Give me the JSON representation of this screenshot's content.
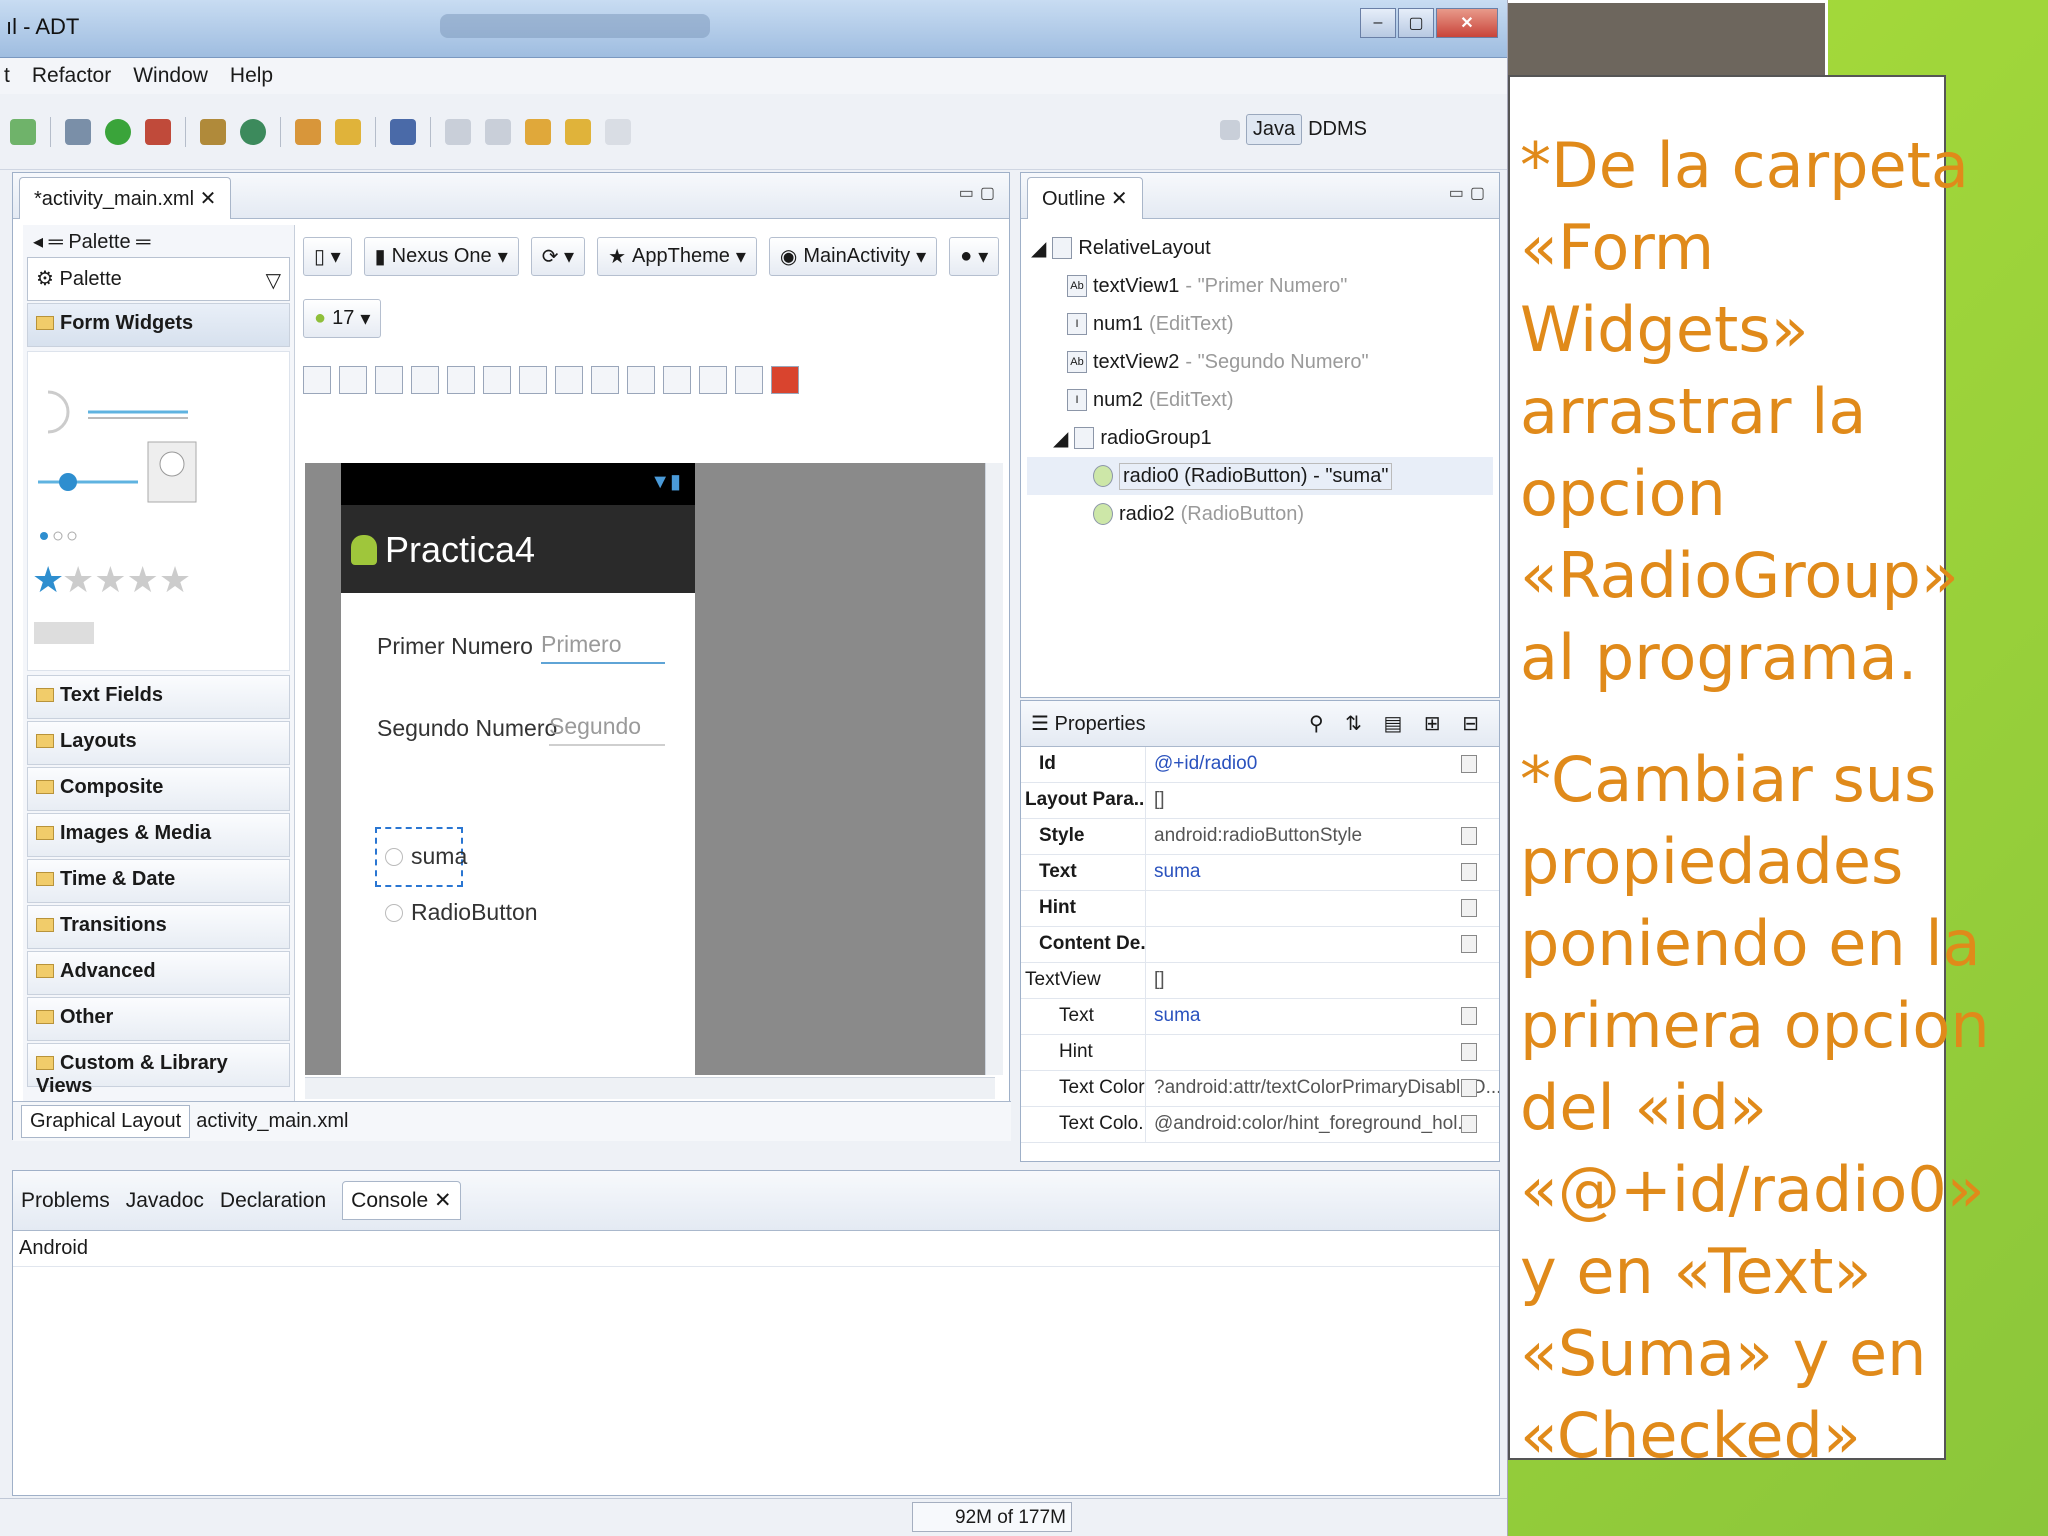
{
  "window": {
    "title": "ıl - ADT"
  },
  "menu": [
    "t",
    "Refactor",
    "Window",
    "Help"
  ],
  "perspectives": {
    "java": "Java",
    "ddms": "DDMS"
  },
  "editor": {
    "tab": "*activity_main.xml",
    "palette": {
      "header": "Palette",
      "filter": "Palette",
      "categories": [
        "Form Widgets",
        "Text Fields",
        "Layouts",
        "Composite",
        "Images & Media",
        "Time & Date",
        "Transitions",
        "Advanced",
        "Other",
        "Custom & Library Views"
      ]
    },
    "canvas_toolbar": {
      "device": "Nexus One",
      "theme": "AppTheme",
      "activity": "MainActivity",
      "api": "17"
    },
    "phone": {
      "title": "Practica4",
      "label1": "Primer Numero",
      "hint1": "Primero",
      "label2": "Segundo Numero",
      "hint2": "Segundo",
      "radio1": "suma",
      "radio2": "RadioButton"
    },
    "bottom_tabs": [
      "Graphical Layout",
      "activity_main.xml"
    ]
  },
  "outline": {
    "title": "Outline",
    "items": [
      {
        "name": "RelativeLayout",
        "extra": ""
      },
      {
        "name": "textView1",
        "extra": " - \"Primer Numero\""
      },
      {
        "name": "num1",
        "extra": " (EditText)"
      },
      {
        "name": "textView2",
        "extra": " - \"Segundo Numero\""
      },
      {
        "name": "num2",
        "extra": " (EditText)"
      },
      {
        "name": "radioGroup1",
        "extra": ""
      },
      {
        "name": "radio0 (RadioButton) - \"suma\"",
        "extra": ""
      },
      {
        "name": "radio2",
        "extra": " (RadioButton)"
      }
    ]
  },
  "properties": {
    "title": "Properties",
    "rows": [
      {
        "name": "Id",
        "value": "@+id/radio0"
      },
      {
        "name": "Layout Para...",
        "value": "[]"
      },
      {
        "name": "Style",
        "value": "android:radioButtonStyle"
      },
      {
        "name": "Text",
        "value": "suma"
      },
      {
        "name": "Hint",
        "value": ""
      },
      {
        "name": "Content De...",
        "value": ""
      },
      {
        "name": "TextView",
        "value": "[]"
      },
      {
        "name": "Text",
        "value": "suma"
      },
      {
        "name": "Hint",
        "value": ""
      },
      {
        "name": "Text Color",
        "value": "?android:attr/textColorPrimaryDisableO..."
      },
      {
        "name": "Text Colo...",
        "value": "@android:color/hint_foreground_hol..."
      }
    ]
  },
  "console": {
    "tabs": [
      "Problems",
      "Javadoc",
      "Declaration",
      "Console"
    ],
    "sub": "Android"
  },
  "status": {
    "heap": "92M of 177M"
  },
  "slide": {
    "p1": "*De la carpeta\n«Form\nWidgets»\narrastrar la\nopcion\n«RadioGroup»\nal programa.",
    "p2": "*Cambiar sus\npropiedades\nponiendo en la\nprimera opcion\ndel «id»\n«@+id/radio0»\ny en «Text»\n«Suma» y en\n«Checked»"
  }
}
